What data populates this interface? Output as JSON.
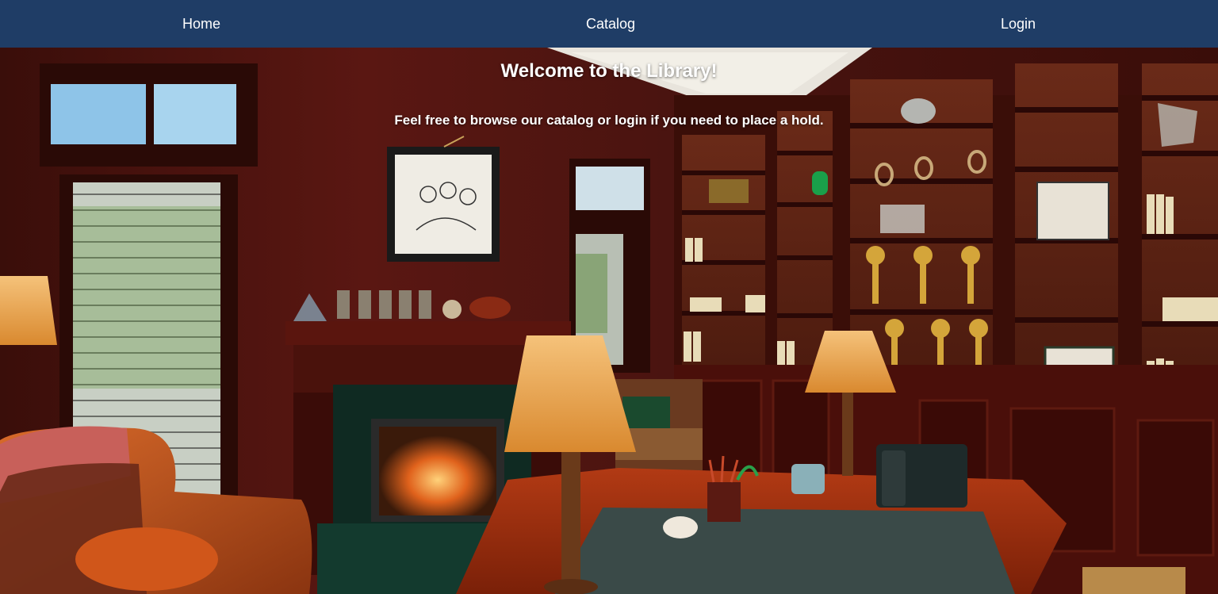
{
  "nav": {
    "items": [
      {
        "label": "Home"
      },
      {
        "label": "Catalog"
      },
      {
        "label": "Login"
      }
    ]
  },
  "hero": {
    "title": "Welcome to the Library!",
    "subtitle": "Feel free to browse our catalog or login if you need to place a hold.",
    "background_image": "library-study-photo"
  },
  "colors": {
    "navbar": "#1f3d66",
    "nav_text": "#ffffff",
    "hero_text": "#ffffff"
  }
}
